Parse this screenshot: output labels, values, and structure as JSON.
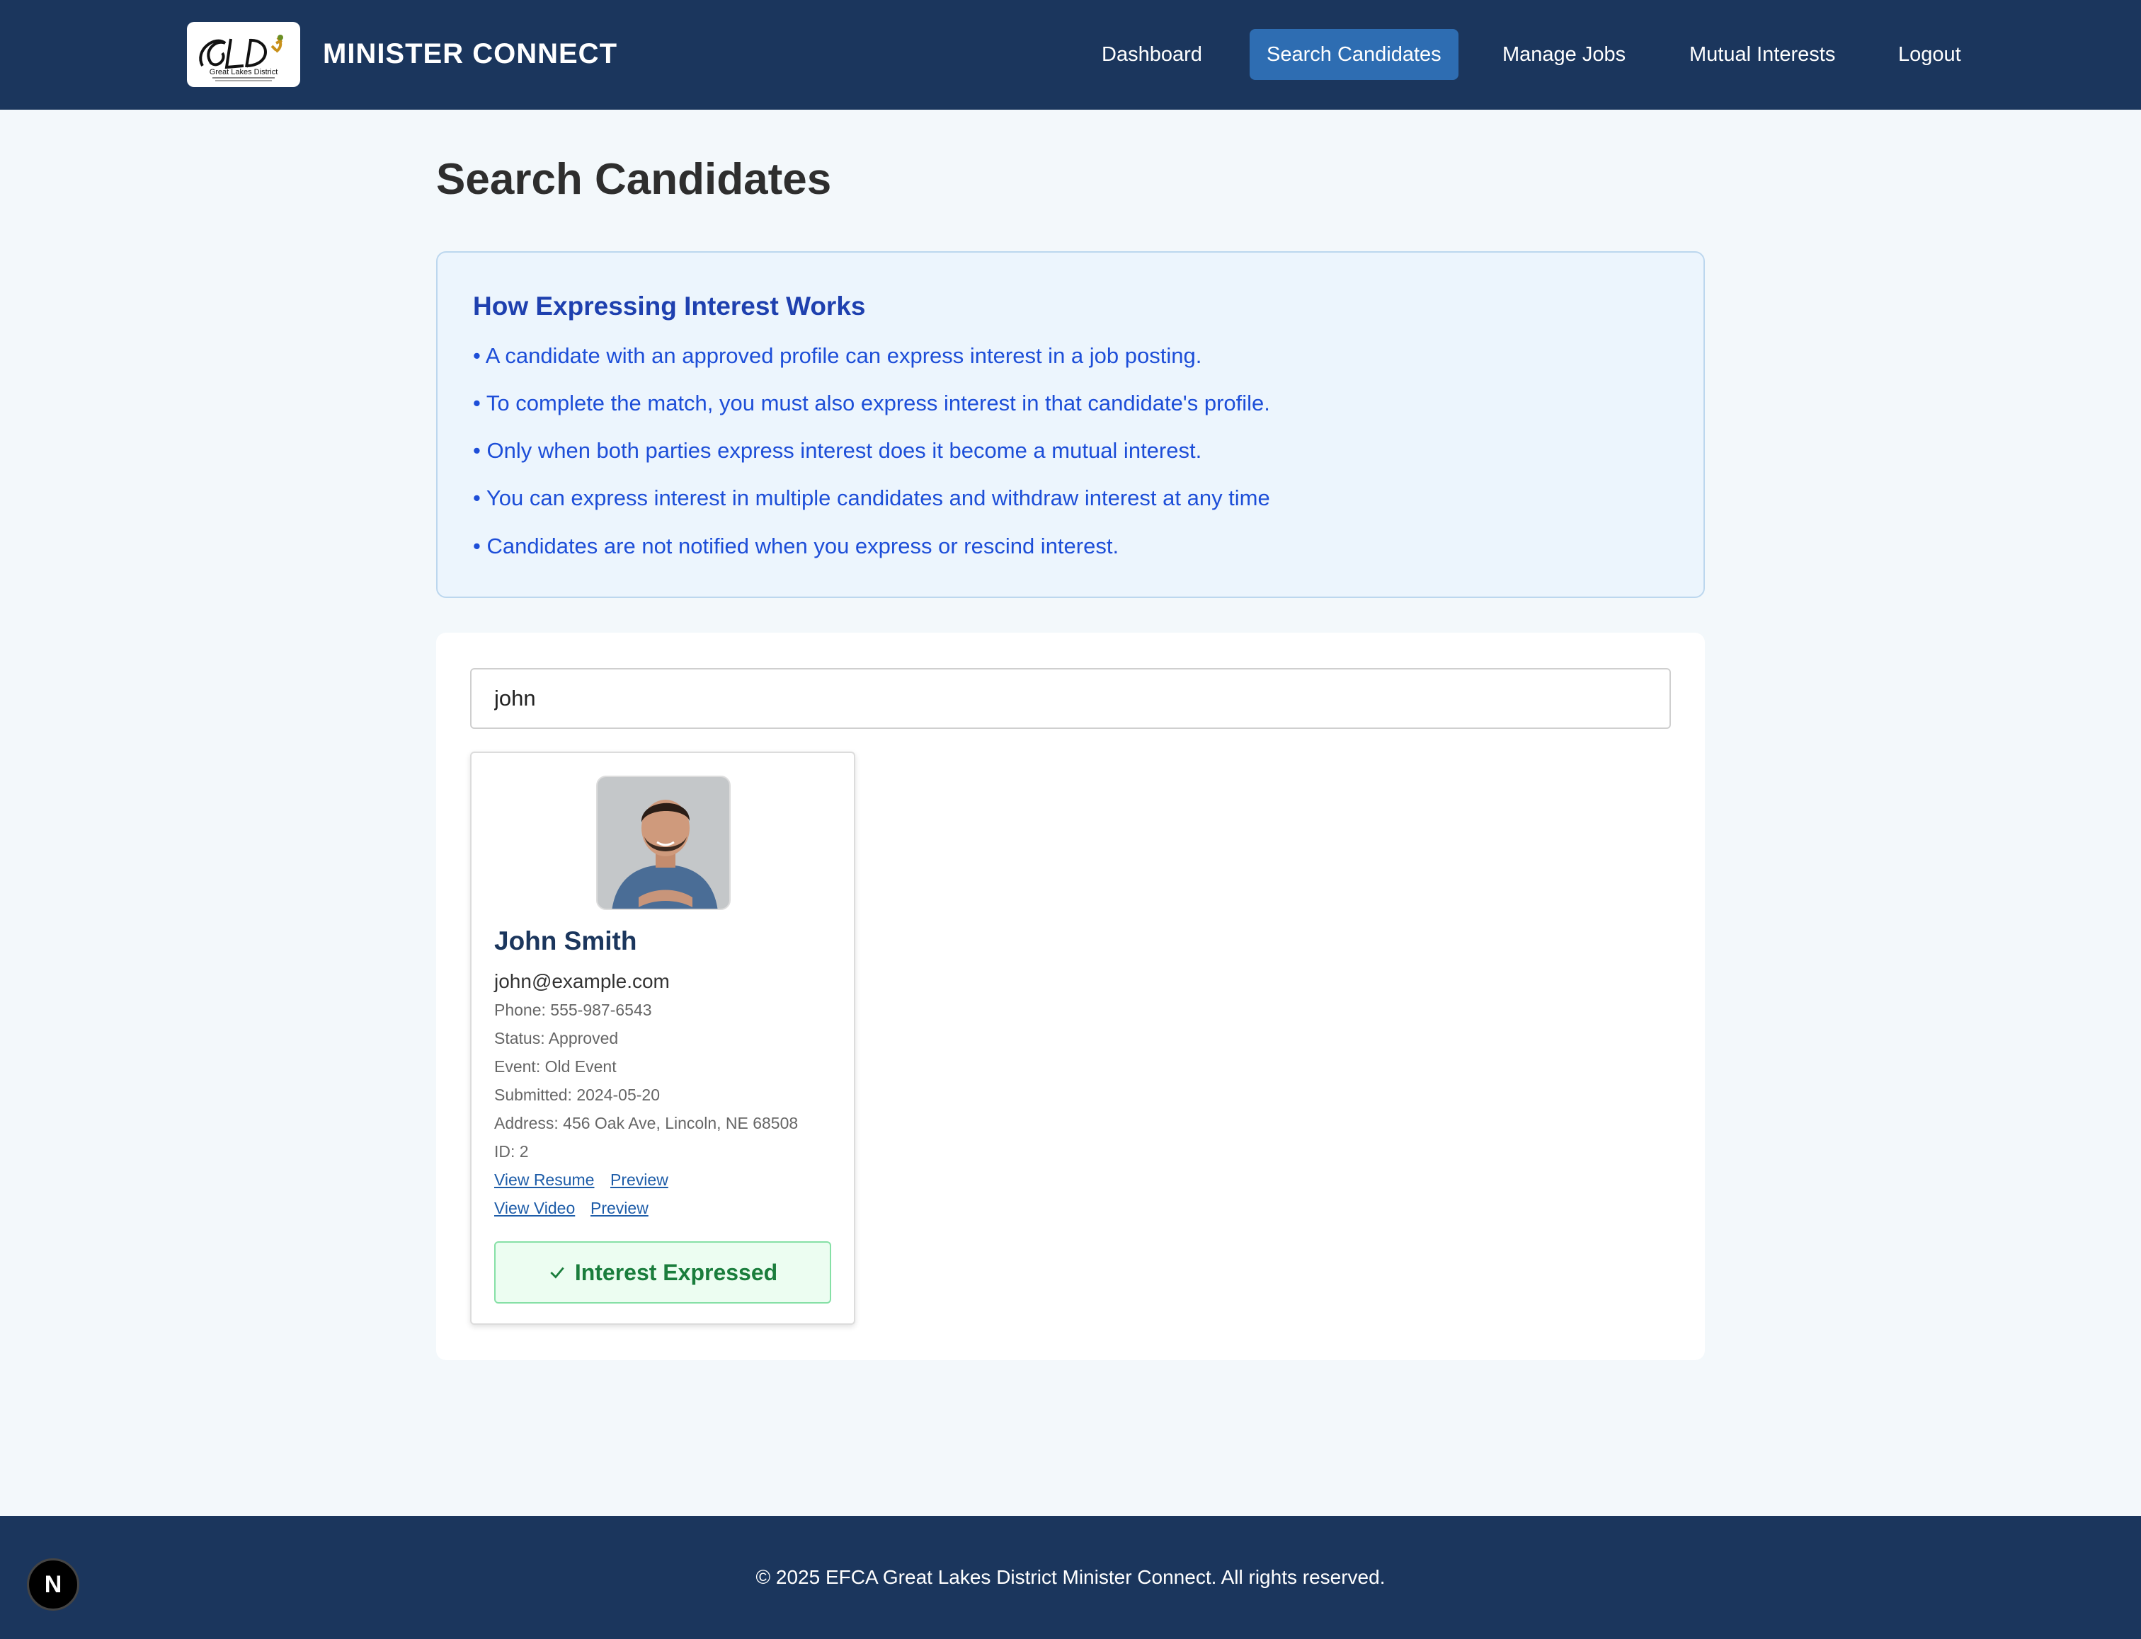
{
  "header": {
    "logo_text": "GLD Great Lakes District Evangelical Free Church of America",
    "brand": "MINISTER CONNECT",
    "nav": [
      {
        "label": "Dashboard",
        "active": false
      },
      {
        "label": "Search Candidates",
        "active": true
      },
      {
        "label": "Manage Jobs",
        "active": false
      },
      {
        "label": "Mutual Interests",
        "active": false
      },
      {
        "label": "Logout",
        "active": false
      }
    ]
  },
  "page": {
    "title": "Search Candidates"
  },
  "info": {
    "title": "How Expressing Interest Works",
    "lines": [
      "• A candidate with an approved profile can express interest in a job posting.",
      "• To complete the match, you must also express interest in that candidate's profile.",
      "• Only when both parties express interest does it become a mutual interest.",
      "• You can express interest in multiple candidates and withdraw interest at any time",
      "• Candidates are not notified when you express or rescind interest."
    ]
  },
  "search": {
    "value": "john",
    "placeholder": ""
  },
  "candidate": {
    "name": "John Smith",
    "email": "john@example.com",
    "phone": "Phone: 555-987-6543",
    "status": "Status: Approved",
    "event": "Event: Old Event",
    "submitted": "Submitted: 2024-05-20",
    "address": "Address: 456 Oak Ave, Lincoln, NE 68508",
    "id": "ID: 2",
    "view_resume": "View Resume",
    "resume_preview": "Preview",
    "view_video": "View Video",
    "video_preview": "Preview",
    "interest_label": "Interest Expressed"
  },
  "footer": {
    "copyright": "© 2025 EFCA Great Lakes District Minister Connect. All rights reserved.",
    "badge": "N"
  },
  "colors": {
    "header_bg": "#1b365d",
    "nav_active": "#2e6db2",
    "info_bg": "#ecf5fd",
    "info_text": "#1d4ed8",
    "success": "#1a7d3c"
  }
}
